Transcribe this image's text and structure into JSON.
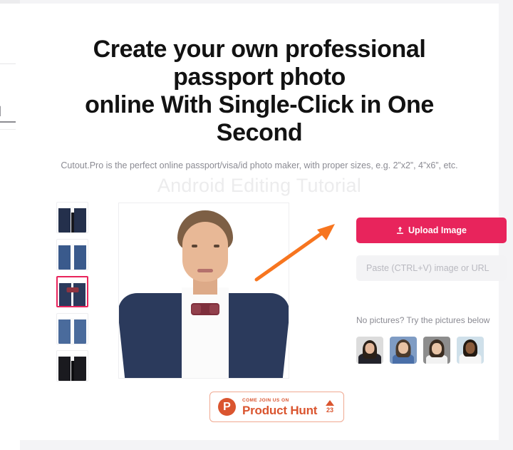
{
  "page": {
    "headline_line1": "Create your own professional passport photo",
    "headline_line2": "online With Single-Click in One Second",
    "subtitle": "Cutout.Pro is the perfect online passport/visa/id photo maker, with proper sizes, e.g. 2”x2”, 4”x6”, etc.",
    "watermark": "Android Editing Tutorial"
  },
  "colors": {
    "accent_pink": "#E8245C",
    "annotation_orange": "#F7751F",
    "product_hunt_orange": "#DA552F",
    "page_background": "#F4F4F6",
    "card_background": "#FFFFFF",
    "muted_text": "#8B8B93"
  },
  "outfits": {
    "selected_index": 2,
    "items": [
      {
        "name": "navy-suit-black-tie",
        "suit": "#24304c",
        "accessory": "tie",
        "accessory_color": "#16171d"
      },
      {
        "name": "blue-suit-open-collar",
        "suit": "#3a5a8c",
        "accessory": "none",
        "accessory_color": ""
      },
      {
        "name": "navy-suit-bow-tie",
        "suit": "#2b3a5c",
        "accessory": "bow",
        "accessory_color": "#8f3340"
      },
      {
        "name": "blue-suit-open-collar-2",
        "suit": "#4a6b9c",
        "accessory": "none",
        "accessory_color": ""
      },
      {
        "name": "black-suit-black-tie",
        "suit": "#1a1a1f",
        "accessory": "tie",
        "accessory_color": "#0d0d10"
      }
    ]
  },
  "preview": {
    "name": "passport-photo-preview",
    "subject": "man in navy suit with maroon bow tie"
  },
  "annotation": {
    "name": "orange-arrow",
    "points_to": "upload-image-button",
    "color": "#F7751F"
  },
  "actions": {
    "upload_label": "Upload Image",
    "upload_icon": "upload-icon",
    "paste_value": "",
    "paste_placeholder": "Paste (CTRL+V) image or URL",
    "try_label": "No pictures? Try the pictures below"
  },
  "samples": [
    {
      "name": "sample-woman-glasses",
      "bg": "#dcdcdc",
      "hair": "#2a2018",
      "skin": "#e3b79a",
      "body": "#22222a"
    },
    {
      "name": "sample-girl-blue",
      "bg": "#7f9cc4",
      "hair": "#4a3a2c",
      "skin": "#e8c2a4",
      "body": "#4a6fa8"
    },
    {
      "name": "sample-boy-gray",
      "bg": "#8d8d8d",
      "hair": "#3a2c20",
      "skin": "#e8c4a6",
      "body": "#f2f2f2"
    },
    {
      "name": "sample-child-uniform",
      "bg": "#cfe0ea",
      "hair": "#231a12",
      "skin": "#8a5c3c",
      "body": "#f6f6f6"
    }
  ],
  "product_hunt": {
    "logo_letter": "P",
    "kicker": "COME JOIN US ON",
    "name": "Product Hunt",
    "vote_count": "23"
  },
  "edge": {
    "glyph": "▏"
  }
}
